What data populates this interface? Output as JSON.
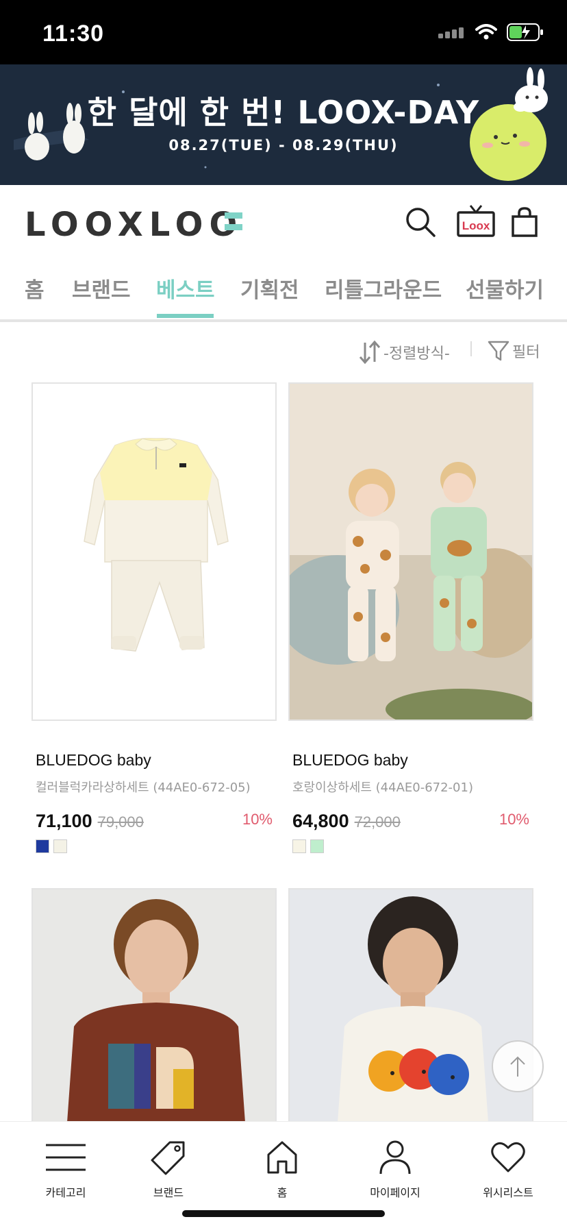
{
  "status_bar": {
    "time": "11:30"
  },
  "banner": {
    "title": "한 달에 한 번! LOOX-DAY",
    "dates": "08.27(TUE) - 08.29(THU)"
  },
  "header": {
    "logo": "LOOXLOO",
    "tv_label": "Loox",
    "icons": [
      "search-icon",
      "loox-tv-icon",
      "shopping-bag-icon"
    ]
  },
  "nav": {
    "tabs": [
      {
        "label": "홈"
      },
      {
        "label": "브랜드"
      },
      {
        "label": "베스트",
        "active": true
      },
      {
        "label": "기획전"
      },
      {
        "label": "리틀그라운드"
      },
      {
        "label": "선물하기"
      }
    ]
  },
  "toolbar": {
    "sort_label": "-정렬방식-",
    "filter_label": "필터"
  },
  "products": [
    {
      "brand": "BLUEDOG baby",
      "name": "컬러블럭카라상하세트 (44AE0-672-05)",
      "price": "71,100",
      "original_price": "79,000",
      "discount": "10%",
      "swatches": [
        "#1f3a9e",
        "#f4f2e6"
      ]
    },
    {
      "brand": "BLUEDOG baby",
      "name": "호랑이상하세트 (44AE0-672-01)",
      "price": "64,800",
      "original_price": "72,000",
      "discount": "10%",
      "swatches": [
        "#f7f4e6",
        "#bfeecd"
      ]
    }
  ],
  "bottom_nav": {
    "items": [
      {
        "label": "카테고리",
        "icon": "menu-icon"
      },
      {
        "label": "브랜드",
        "icon": "tag-icon"
      },
      {
        "label": "홈",
        "icon": "home-icon"
      },
      {
        "label": "마이페이지",
        "icon": "user-icon"
      },
      {
        "label": "위시리스트",
        "icon": "heart-icon"
      }
    ]
  },
  "colors": {
    "accent": "#7bcfc3",
    "discount": "#e05a6d",
    "banner_bg": "#1d2b3d"
  }
}
